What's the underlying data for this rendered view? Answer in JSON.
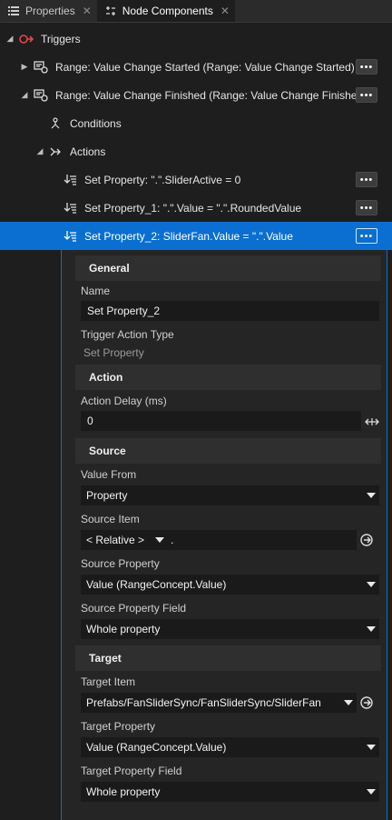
{
  "tabs": [
    {
      "label": "Properties",
      "close": "✕"
    },
    {
      "label": "Node Components",
      "close": "✕"
    }
  ],
  "tree": {
    "triggers": "Triggers",
    "row1": "Range: Value Change Started (Range: Value Change Started)",
    "row2": "Range: Value Change Finished (Range: Value Change Finished)",
    "conditions": "Conditions",
    "actions": "Actions",
    "action1": "Set Property: \".\".SliderActive = 0",
    "action2": "Set Property_1: \".\".Value = \".\".RoundedValue",
    "action3": "Set Property_2: SliderFan.Value = \".\".Value",
    "more": "•••"
  },
  "details": {
    "general": "General",
    "name_label": "Name",
    "name_value": "Set Property_2",
    "trigger_type_label": "Trigger Action Type",
    "trigger_type_value": "Set Property",
    "action": "Action",
    "delay_label": "Action Delay (ms)",
    "delay_value": "0",
    "source": "Source",
    "value_from_label": "Value From",
    "value_from_value": "Property",
    "source_item_label": "Source Item",
    "source_item_relative": "< Relative >",
    "source_item_path": ".",
    "source_property_label": "Source Property",
    "source_property_value": "Value (RangeConcept.Value)",
    "source_field_label": "Source Property Field",
    "source_field_value": "Whole property",
    "target": "Target",
    "target_item_label": "Target Item",
    "target_item_value": "Prefabs/FanSliderSync/FanSliderSync/SliderFan",
    "target_property_label": "Target Property",
    "target_property_value": "Value (RangeConcept.Value)",
    "target_field_label": "Target Property Field",
    "target_field_value": "Whole property"
  },
  "colors": {
    "accent": "#0a6fd1",
    "trigger_red": "#e0484f"
  }
}
